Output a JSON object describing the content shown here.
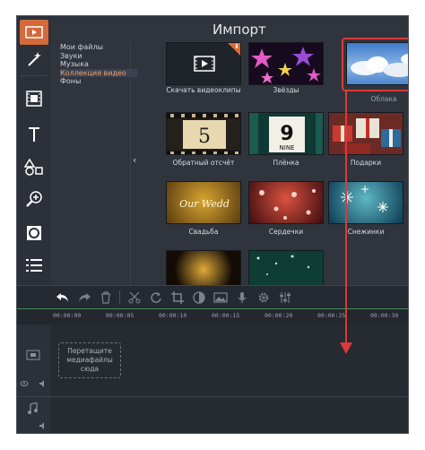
{
  "panel": {
    "title": "Импорт",
    "categories": [
      "Мои файлы",
      "Звуки",
      "Музыка",
      "Коллекция видео",
      "Фоны"
    ],
    "selected_category": "Коллекция видео",
    "collapse_glyph": "‹",
    "items": [
      {
        "label": "Скачать видеоклипы",
        "badge": "⬇"
      },
      {
        "label": "Звёзды"
      },
      {
        "label": "Облака"
      },
      {
        "label": "Обратный отсчёт",
        "number": "5"
      },
      {
        "label": "Плёнка",
        "number": "9",
        "sub": "NINE"
      },
      {
        "label": "Подарки"
      },
      {
        "label": "Свадьба",
        "script": "Our Wedd"
      },
      {
        "label": "Сердечки"
      },
      {
        "label": "Снежинки"
      },
      {
        "label": ""
      },
      {
        "label": ""
      }
    ]
  },
  "timeline": {
    "ticks": [
      "00:00:00",
      "00:00:05",
      "00:00:10",
      "00:00:15",
      "00:00:20",
      "00:00:25",
      "00:00:30"
    ],
    "drop_hint": "Перетащите медиафайлы сюда"
  },
  "colors": {
    "accent": "#d46a3a",
    "highlight": "#d93a3a",
    "bg": "#2a2f38"
  }
}
